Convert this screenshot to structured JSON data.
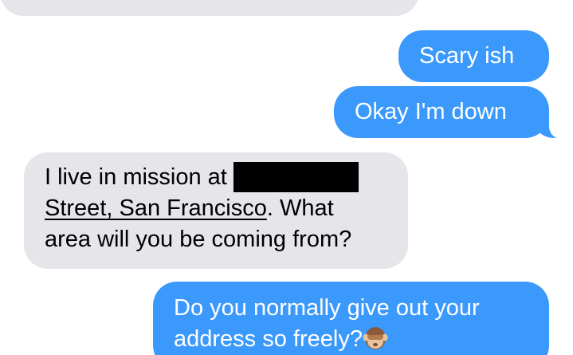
{
  "messages": {
    "top_partial": {
      "text": ""
    },
    "scary": {
      "text": "Scary ish"
    },
    "okay": {
      "text": "Okay I'm down"
    },
    "address": {
      "line1_pre": "I live in mission at",
      "line2_link": "Street, San Francisco",
      "line2_post": ". What",
      "line3": "area will you be coming from?"
    },
    "question": {
      "line1": "Do you normally give out your",
      "line2": "address so freely?",
      "emoji_icon": "see-no-evil-monkey-icon"
    }
  },
  "colors": {
    "sent_bubble": "#3b99fc",
    "received_bubble": "#e5e5ea",
    "redaction": "#000000"
  }
}
